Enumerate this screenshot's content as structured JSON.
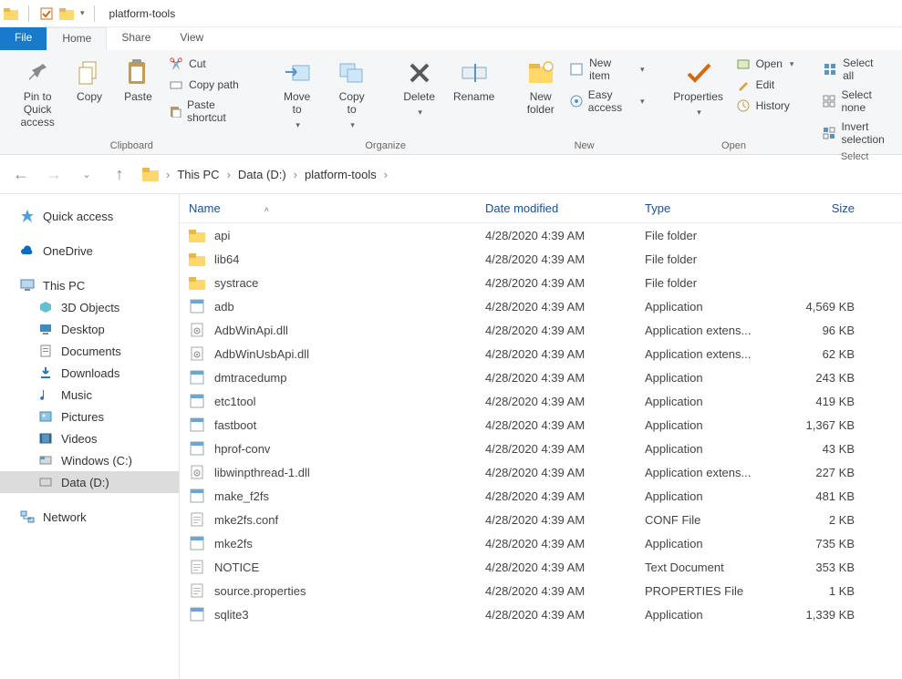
{
  "title": "platform-tools",
  "tabs": {
    "file": "File",
    "home": "Home",
    "share": "Share",
    "view": "View"
  },
  "ribbon": {
    "clipboard": {
      "label": "Clipboard",
      "pin": "Pin to Quick\naccess",
      "copy": "Copy",
      "paste": "Paste",
      "cut": "Cut",
      "copypath": "Copy path",
      "pasteshortcut": "Paste shortcut"
    },
    "organize": {
      "label": "Organize",
      "moveto": "Move\nto",
      "copyto": "Copy\nto",
      "delete": "Delete",
      "rename": "Rename"
    },
    "new": {
      "label": "New",
      "newfolder": "New\nfolder",
      "newitem": "New item",
      "easyaccess": "Easy access"
    },
    "open": {
      "label": "Open",
      "properties": "Properties",
      "open": "Open",
      "edit": "Edit",
      "history": "History"
    },
    "select": {
      "label": "Select",
      "all": "Select all",
      "none": "Select none",
      "invert": "Invert selection"
    }
  },
  "breadcrumb": [
    "This PC",
    "Data (D:)",
    "platform-tools"
  ],
  "sidebar": {
    "quick": "Quick access",
    "onedrive": "OneDrive",
    "thispc": "This PC",
    "children": [
      "3D Objects",
      "Desktop",
      "Documents",
      "Downloads",
      "Music",
      "Pictures",
      "Videos",
      "Windows (C:)",
      "Data (D:)"
    ],
    "network": "Network"
  },
  "columns": {
    "name": "Name",
    "date": "Date modified",
    "type": "Type",
    "size": "Size"
  },
  "items": [
    {
      "icon": "folder",
      "name": "api",
      "date": "4/28/2020 4:39 AM",
      "type": "File folder",
      "size": ""
    },
    {
      "icon": "folder",
      "name": "lib64",
      "date": "4/28/2020 4:39 AM",
      "type": "File folder",
      "size": ""
    },
    {
      "icon": "folder",
      "name": "systrace",
      "date": "4/28/2020 4:39 AM",
      "type": "File folder",
      "size": ""
    },
    {
      "icon": "app",
      "name": "adb",
      "date": "4/28/2020 4:39 AM",
      "type": "Application",
      "size": "4,569 KB"
    },
    {
      "icon": "dll",
      "name": "AdbWinApi.dll",
      "date": "4/28/2020 4:39 AM",
      "type": "Application extens...",
      "size": "96 KB"
    },
    {
      "icon": "dll",
      "name": "AdbWinUsbApi.dll",
      "date": "4/28/2020 4:39 AM",
      "type": "Application extens...",
      "size": "62 KB"
    },
    {
      "icon": "app",
      "name": "dmtracedump",
      "date": "4/28/2020 4:39 AM",
      "type": "Application",
      "size": "243 KB"
    },
    {
      "icon": "app",
      "name": "etc1tool",
      "date": "4/28/2020 4:39 AM",
      "type": "Application",
      "size": "419 KB"
    },
    {
      "icon": "app",
      "name": "fastboot",
      "date": "4/28/2020 4:39 AM",
      "type": "Application",
      "size": "1,367 KB"
    },
    {
      "icon": "app",
      "name": "hprof-conv",
      "date": "4/28/2020 4:39 AM",
      "type": "Application",
      "size": "43 KB"
    },
    {
      "icon": "dll",
      "name": "libwinpthread-1.dll",
      "date": "4/28/2020 4:39 AM",
      "type": "Application extens...",
      "size": "227 KB"
    },
    {
      "icon": "app",
      "name": "make_f2fs",
      "date": "4/28/2020 4:39 AM",
      "type": "Application",
      "size": "481 KB"
    },
    {
      "icon": "txt",
      "name": "mke2fs.conf",
      "date": "4/28/2020 4:39 AM",
      "type": "CONF File",
      "size": "2 KB"
    },
    {
      "icon": "app",
      "name": "mke2fs",
      "date": "4/28/2020 4:39 AM",
      "type": "Application",
      "size": "735 KB"
    },
    {
      "icon": "txt",
      "name": "NOTICE",
      "date": "4/28/2020 4:39 AM",
      "type": "Text Document",
      "size": "353 KB"
    },
    {
      "icon": "txt",
      "name": "source.properties",
      "date": "4/28/2020 4:39 AM",
      "type": "PROPERTIES File",
      "size": "1 KB"
    },
    {
      "icon": "app",
      "name": "sqlite3",
      "date": "4/28/2020 4:39 AM",
      "type": "Application",
      "size": "1,339 KB"
    }
  ]
}
